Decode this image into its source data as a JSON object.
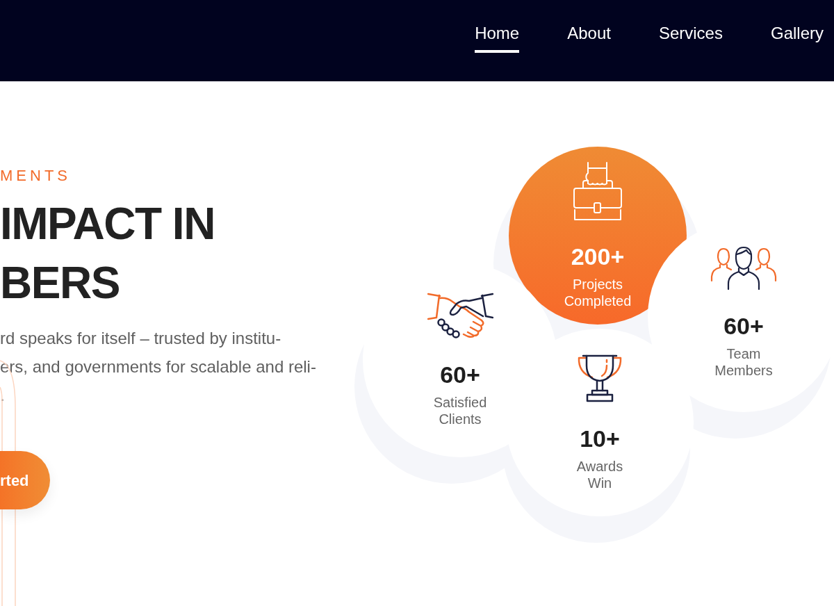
{
  "nav": {
    "items": [
      {
        "label": "Home",
        "selected": true
      },
      {
        "label": "About",
        "selected": false
      },
      {
        "label": "Services",
        "selected": false
      },
      {
        "label": "Gallery",
        "selected": false
      }
    ]
  },
  "hero": {
    "eyebrow": "MENTS",
    "heading_lines": [
      "IMPACT IN",
      "BERS"
    ],
    "paragraph_lines": [
      "rd speaks for itself – trusted by institu-",
      "ers, and governments for scalable and reli-",
      "."
    ],
    "button": {
      "label": "rted"
    }
  },
  "stats": [
    {
      "kind": "highlight",
      "value": "200+",
      "label": "Projects Completed"
    },
    {
      "kind": "plain",
      "value": "60+",
      "label": "Team Members"
    },
    {
      "kind": "plain",
      "value": "60+",
      "label": "Satisfied Clients"
    },
    {
      "kind": "plain",
      "value": "10+",
      "label": "Awards Win"
    }
  ]
}
